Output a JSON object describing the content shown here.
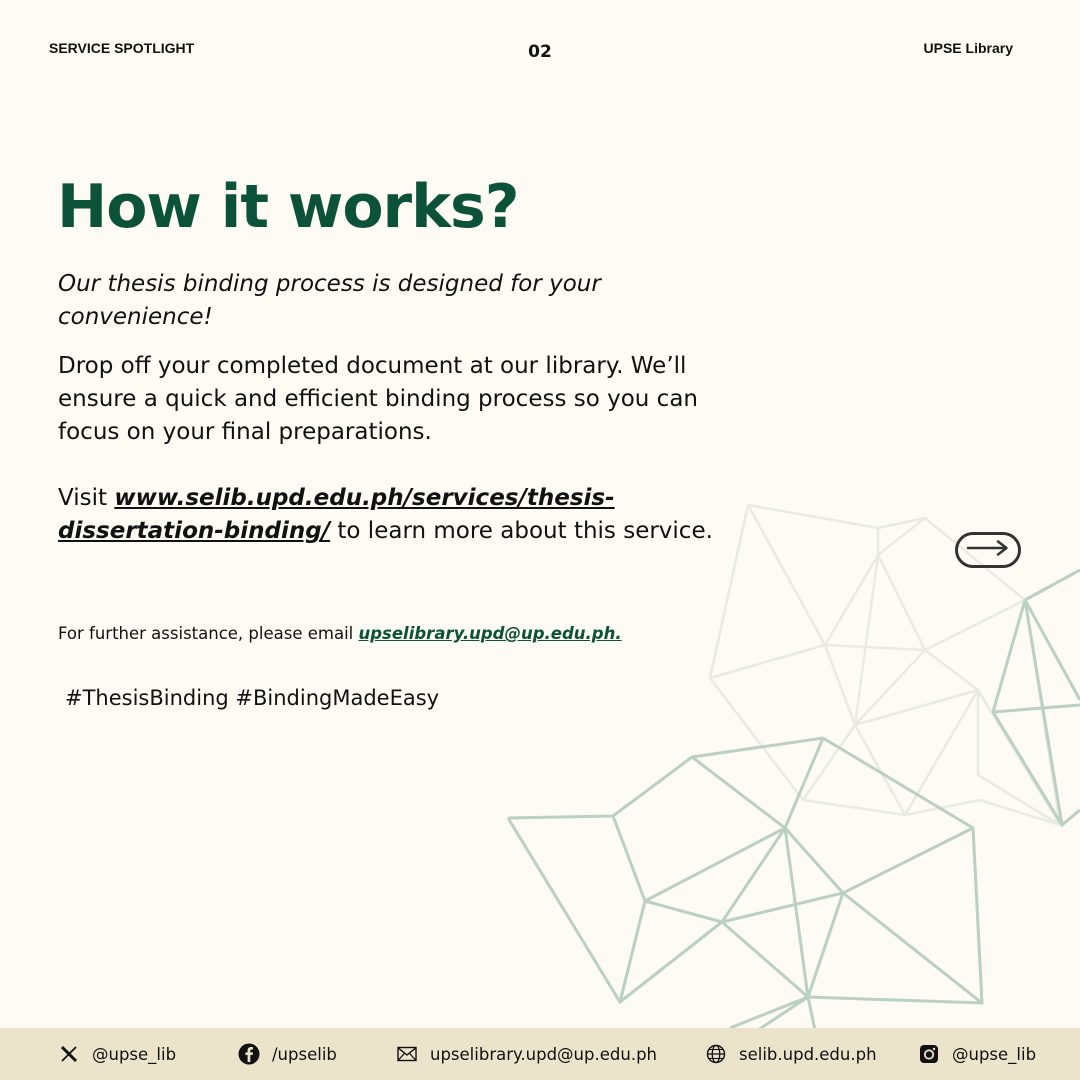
{
  "header": {
    "left": "SERVICE SPOTLIGHT",
    "page_number": "02",
    "right": "UPSE Library"
  },
  "main": {
    "title": "How it works?",
    "subtitle": "Our thesis binding process is designed for your convenience!",
    "body": "Drop off your completed document at our library. We’ll ensure a quick and efficient binding process so you can focus on your final preparations.",
    "visit_prefix": "Visit ",
    "visit_link": "www.selib.upd.edu.ph/services/thesis-dissertation-binding/",
    "visit_suffix": " to learn more about this service.",
    "assist_prefix": "For further assistance, please email ",
    "assist_email": "upselibrary.upd@up.edu.ph.",
    "hashtags": "#ThesisBinding #BindingMadeEasy"
  },
  "icons": {
    "next": "arrow-right-icon",
    "x": "x-twitter-icon",
    "facebook": "facebook-icon",
    "email": "envelope-icon",
    "web": "globe-icon",
    "instagram": "instagram-icon"
  },
  "colors": {
    "background": "#fdfbf4",
    "accent": "#0b5238",
    "footer": "#ebe4ca",
    "line_art": "#b9d0c3"
  },
  "footer": {
    "twitter": "@upse_lib",
    "facebook": "/upselib",
    "email": "upselibrary.upd@up.edu.ph",
    "website": "selib.upd.edu.ph",
    "instagram": "@upse_lib"
  }
}
